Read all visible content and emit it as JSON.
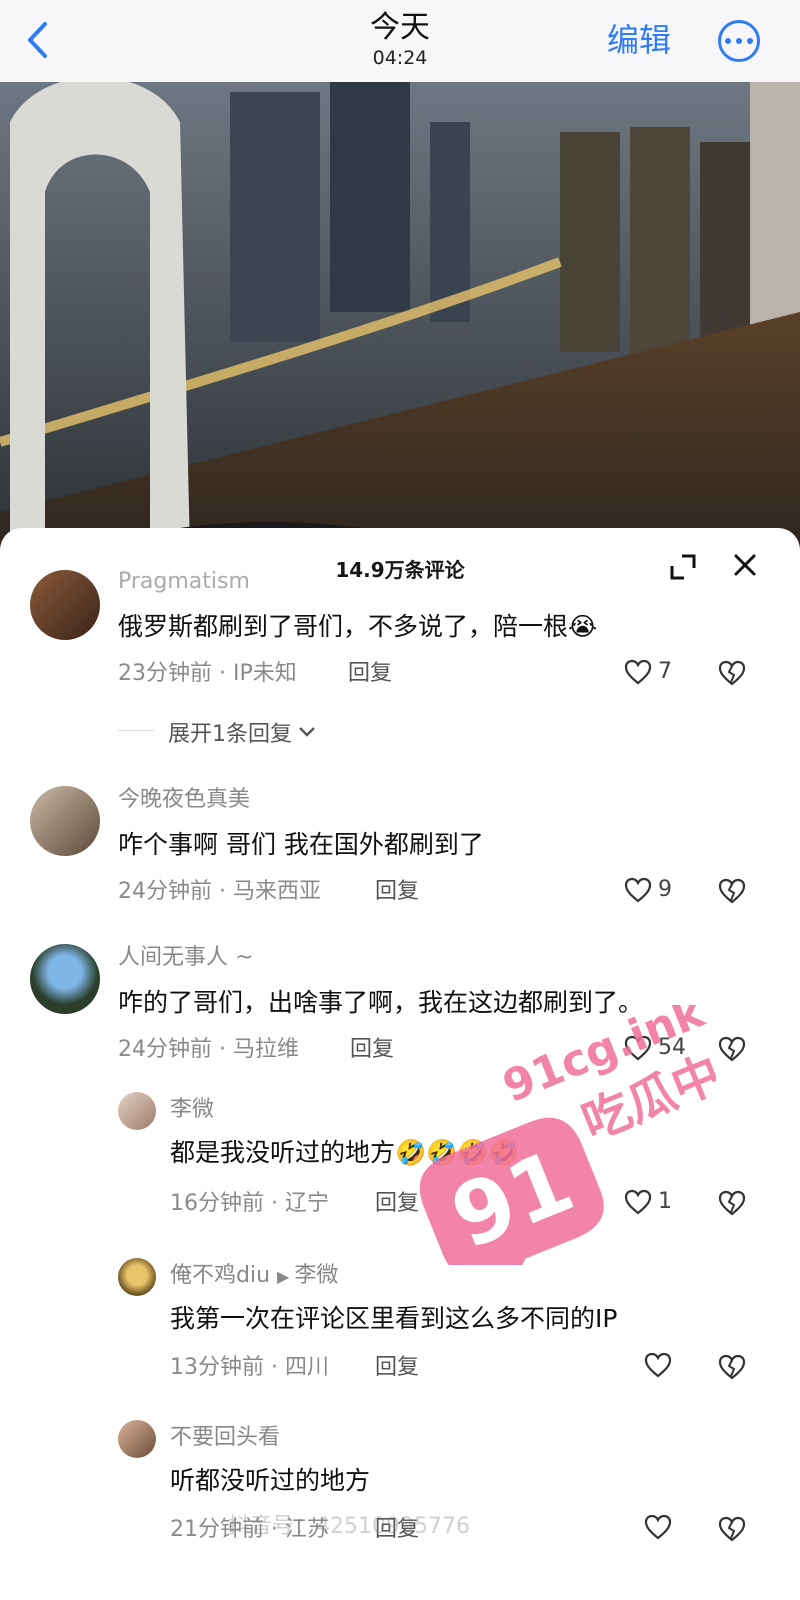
{
  "header": {
    "back_icon": "chevron-left-icon",
    "day": "今天",
    "time": "04:24",
    "edit_label": "编辑",
    "more_icon": "ellipsis-circle-icon",
    "accent": "#2f7cf6"
  },
  "sheet": {
    "title": "14.9万条评论",
    "expand_icon": "expand-icon",
    "close_icon": "close-icon"
  },
  "comments": [
    {
      "user": "Pragmatism",
      "text": "俄罗斯都刷到了哥们，不多说了，陪一根😭",
      "time": "23分钟前",
      "location": "IP未知",
      "reply_label": "回复",
      "likes": "7"
    },
    {
      "user": "今晚夜色真美",
      "text": "咋个事啊 哥们 我在国外都刷到了",
      "time": "24分钟前",
      "location": "马来西亚",
      "reply_label": "回复",
      "likes": "9"
    },
    {
      "user": "人间无事人 ~",
      "text": "咋的了哥们，出啥事了啊，我在这边都刷到了。",
      "time": "24分钟前",
      "location": "马拉维",
      "reply_label": "回复",
      "likes": "54"
    }
  ],
  "expand_replies": "展开1条回复",
  "replies": [
    {
      "user": "李微",
      "text": "都是我没听过的地方🤣🤣🤣🤣",
      "time": "16分钟前",
      "location": "辽宁",
      "reply_label": "回复",
      "likes": "1"
    },
    {
      "user": "俺不鸡diu",
      "reply_to": "李微",
      "text": "我第一次在评论区里看到这么多不同的IP",
      "time": "13分钟前",
      "location": "四川",
      "reply_label": "回复",
      "likes": ""
    },
    {
      "user": "不要回头看",
      "text": "听都没听过的地方",
      "time": "21分钟前",
      "location": "江苏",
      "reply_label": "回复",
      "likes": ""
    }
  ],
  "watermark": {
    "brand_number": "91",
    "site": "91cg.ink",
    "slogan": "吃瓜中心",
    "color": "#f26f9b"
  },
  "tiktok_id": "抖音号：42510995776"
}
